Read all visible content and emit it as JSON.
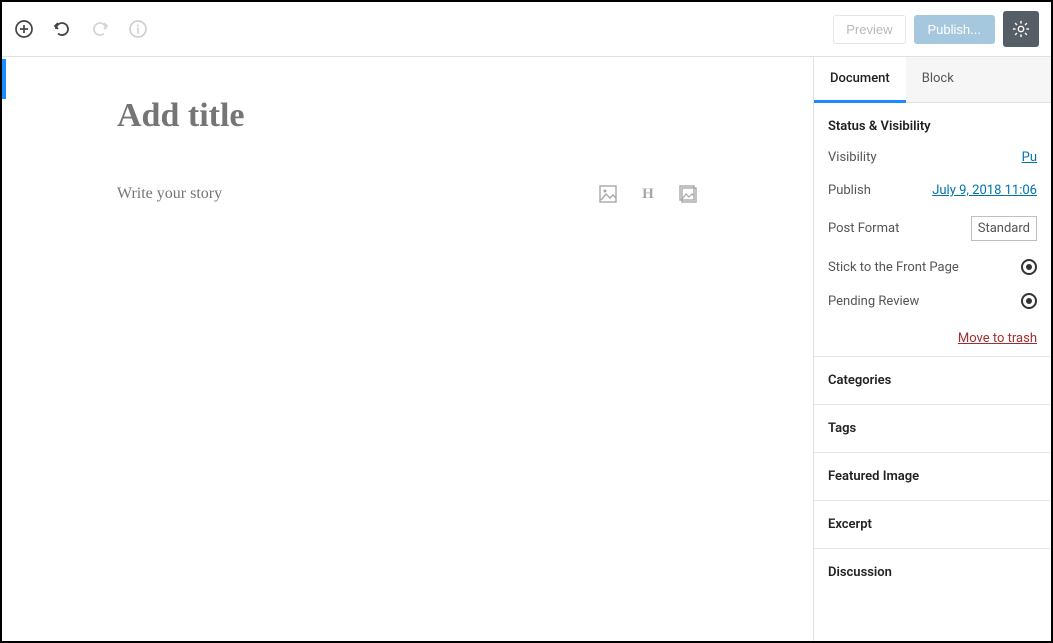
{
  "toolbar": {
    "preview_label": "Preview",
    "publish_label": "Publish..."
  },
  "editor": {
    "title_placeholder": "Add title",
    "story_placeholder": "Write your story"
  },
  "sidebar": {
    "tabs": {
      "document": "Document",
      "block": "Block"
    },
    "status": {
      "heading": "Status & Visibility",
      "visibility_label": "Visibility",
      "visibility_value": "Pu",
      "publish_label": "Publish",
      "publish_value": "July 9, 2018 11:06",
      "postformat_label": "Post Format",
      "postformat_value": "Standard",
      "sticky_label": "Stick to the Front Page",
      "pending_label": "Pending Review",
      "trash_label": "Move to trash"
    },
    "panels": {
      "categories": "Categories",
      "tags": "Tags",
      "featured_image": "Featured Image",
      "excerpt": "Excerpt",
      "discussion": "Discussion"
    }
  }
}
